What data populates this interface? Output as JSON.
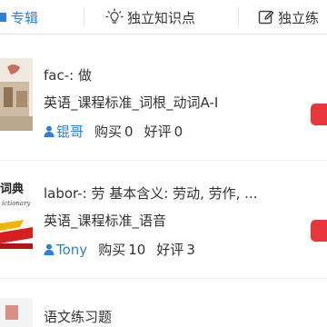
{
  "tabs": [
    {
      "label": "专辑",
      "icon": "album-icon",
      "active": true
    },
    {
      "label": "独立知识点",
      "icon": "lightbulb-icon",
      "active": false
    },
    {
      "label": "独立练",
      "icon": "edit-icon",
      "active": false
    }
  ],
  "colors": {
    "accent": "#2f7fd6",
    "action": "#e8363c",
    "divider": "#ededed"
  },
  "items": [
    {
      "title": "fac-: 做",
      "subtitle": "英语_课程标准_词根_动词A-I",
      "author": "锟哥",
      "purchase_label": "购买",
      "purchase_count": "0",
      "rating_label": "好评",
      "rating_count": "0",
      "thumbnail_icon": "textbook-cover-icon"
    },
    {
      "title": "labor-: 劳  基本含义: 劳动, 劳作, ...",
      "subtitle": "英语_课程标准_语音",
      "author": "Tony",
      "purchase_label": "购买",
      "purchase_count": "10",
      "rating_label": "好评",
      "rating_count": "3",
      "thumbnail_icon": "dictionary-cover-icon"
    },
    {
      "title": "语文练习题",
      "thumbnail_icon": "exercise-cover-icon"
    }
  ]
}
